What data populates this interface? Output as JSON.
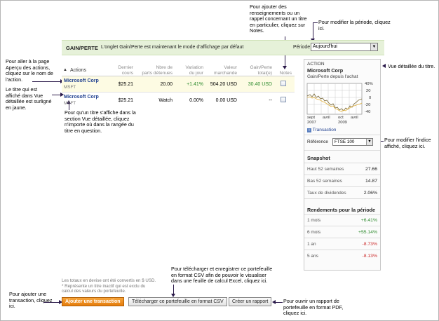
{
  "annotations": {
    "notes_help": [
      "Pour ajouter des",
      "renseignements ou un",
      "rappel concernant un titre",
      "en particulier, cliquez sur",
      "Notes."
    ],
    "period_help": [
      "Pour modifier la période, cliquez",
      "ici."
    ],
    "overview_help": [
      "Pour aller à la page",
      "Aperçu des actions,",
      "cliquez sur le nom de",
      "l'action."
    ],
    "highlight_help": [
      "Le titre qui est",
      "affiché dans Vue",
      "détaillée est surligné",
      "en jaune."
    ],
    "detail_help": [
      "Pour qu'un titre s'affiche dans la",
      "section Vue détaillée, cliquez",
      "n'importe où dans la rangée du",
      "titre en question."
    ],
    "detail_view": "Vue détaillée du titre.",
    "index_help": [
      "Pour modifier l'indice",
      "affiché, cliquez ici."
    ],
    "csv_help": [
      "Pour télécharger et enregistrer ce portefeuille",
      "en format CSV afin de pouvoir le visualiser",
      "dans une feuille de calcul Excel, cliquez ici."
    ],
    "pdf_help": [
      "Pour ouvrir un rapport de",
      "portefeuille en format PDF,",
      "cliquez ici."
    ],
    "add_help": [
      "Pour ajouter une",
      "transaction, cliquez",
      "ici."
    ]
  },
  "banner": {
    "title": "GAIN/PERTE",
    "message": "L'onglet Gain/Perte est maintenant le mode d'affichage par défaut",
    "period_label": "Période",
    "period_value": "Aujourd'hui"
  },
  "table": {
    "headers": {
      "actions": "Actions",
      "last_price": [
        "Dernier",
        "cours"
      ],
      "shares": [
        "Nbre de",
        "parts détenues"
      ],
      "day_change": [
        "Variation",
        "du jour"
      ],
      "market_value": [
        "Valeur",
        "marchande"
      ],
      "gain_loss": [
        "Gain/Perte",
        "total(e)"
      ],
      "notes": "Notes"
    },
    "rows": [
      {
        "name": "Microsoft Corp",
        "ticker": "MSFT",
        "price": "$25.21",
        "shares": "20.00",
        "change": "+1.41%",
        "value": "504.20 USD",
        "gain": "30.40 USD"
      },
      {
        "name": "Microsoft Corp",
        "ticker": "MSFT",
        "price": "$25.21",
        "shares": "Watch",
        "change": "0.00%",
        "value": "0.00 USD",
        "gain": "--"
      }
    ]
  },
  "detail": {
    "section_label": "ACTION",
    "stock_name": "Microsoft Corp",
    "subtitle": "Gain/Perte depuis l'achat",
    "y_ticks": [
      "40%",
      "20",
      "0",
      "-20",
      "-40"
    ],
    "x_ticks": [
      "sept",
      "avril",
      "oct",
      "avril"
    ],
    "x_years": [
      "2007",
      "2009"
    ],
    "transaction_link": "Transaction",
    "reference_label": "Référence",
    "reference_value": "FTSE 100",
    "snapshot_title": "Snapshot",
    "snapshot": [
      {
        "label": "Haut 52 semaines",
        "value": "27.66"
      },
      {
        "label": "Bas 52 semaines",
        "value": "14.87"
      },
      {
        "label": "Taux de dividendes",
        "value": "2.06%"
      }
    ],
    "returns_title": "Rendements pour la période",
    "returns": [
      {
        "label": "1 mois",
        "value": "+6.41%"
      },
      {
        "label": "6 mois",
        "value": "+55.14%"
      },
      {
        "label": "1 an",
        "value": "-8.73%"
      },
      {
        "label": "5 ans",
        "value": "-8.13%"
      }
    ]
  },
  "footer": {
    "note1": "Les totaux en devise ont été convertis en $ USD.",
    "note2": "* Représente un titre inactif qui est exclu du",
    "note3": "calcul des valeurs du portefeuille.",
    "add_button": "Ajouter une transaction",
    "csv_button": "Télécharger ce portefeuille en format CSV",
    "report_button": "Créer un rapport"
  },
  "colors": {
    "accent_green_bg": "#e6f1d9",
    "link_blue": "#1f3f8f",
    "positive": "#2e8b2e",
    "negative": "#cc2a2a",
    "highlight": "#fdfbe3",
    "orange_button": "#e57c0c"
  }
}
